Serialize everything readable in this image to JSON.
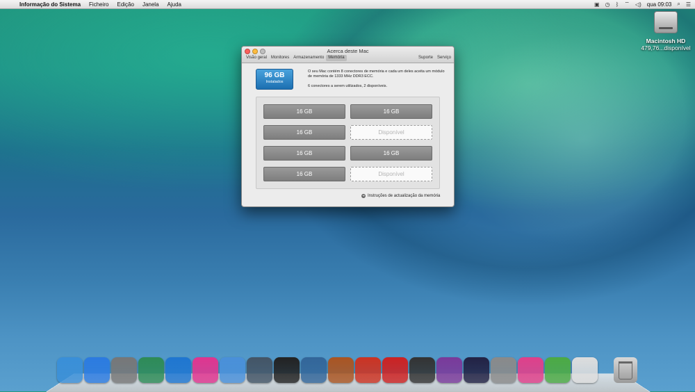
{
  "menubar": {
    "app_name": "Informação do Sistema",
    "items": [
      "Ficheiro",
      "Edição",
      "Janela",
      "Ajuda"
    ],
    "clock": "qua 09:03"
  },
  "desktop": {
    "disk_name": "Macintosh HD",
    "disk_sub": "479,76...disponível"
  },
  "window": {
    "title": "Acerca deste Mac",
    "tabs": [
      "Visão geral",
      "Monitores",
      "Armazenamento",
      "Memória"
    ],
    "active_tab": "Memória",
    "right_tabs": [
      "Suporte",
      "Serviço"
    ],
    "badge_value": "96 GB",
    "badge_label": "Instalados",
    "description_1": "O seu Mac contém 8 conectores de memória e cada um deles aceita um módulo de memória de 1333 MHz DDR3 ECC.",
    "description_2": "6 conectores a serem utilizados, 2 disponíveis.",
    "slots": [
      {
        "label": "16 GB",
        "state": "filled"
      },
      {
        "label": "16 GB",
        "state": "filled"
      },
      {
        "label": "16 GB",
        "state": "filled"
      },
      {
        "label": "Disponível",
        "state": "empty"
      },
      {
        "label": "16 GB",
        "state": "filled"
      },
      {
        "label": "16 GB",
        "state": "filled"
      },
      {
        "label": "16 GB",
        "state": "filled"
      },
      {
        "label": "Disponível",
        "state": "empty"
      }
    ],
    "upgrade_link": "Instruções de actualização da memória"
  },
  "dock": {
    "icons": [
      "finder-icon",
      "app-store-icon",
      "launchpad-icon",
      "monopoly-icon",
      "safari-icon",
      "itunes-icon",
      "applications-folder-icon",
      "preview-icon",
      "final-cut-icon",
      "compressor-icon",
      "amplitube-icon",
      "reason-icon",
      "blocked-app-icon",
      "disk-utility-icon",
      "motion-icon",
      "logic-icon",
      "system-preferences-icon",
      "display-icon",
      "memory-icon",
      "system-info-icon"
    ],
    "colors": [
      "#3a8fd8",
      "#2c7be0",
      "#777777",
      "#2e8b57",
      "#1f76d0",
      "#e0358f",
      "#4a90d9",
      "#445566",
      "#222222",
      "#336699",
      "#aa5522",
      "#cc3322",
      "#cc2222",
      "#333333",
      "#7a3a9a",
      "#222244",
      "#8a8a8a",
      "#e0408a",
      "#4caa44",
      "#dddddd"
    ]
  }
}
